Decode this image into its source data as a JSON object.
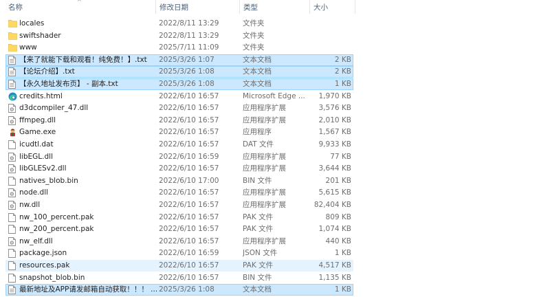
{
  "header": {
    "name": "名称",
    "date": "修改日期",
    "type": "类型",
    "size": "大小",
    "sort_arrow": "^"
  },
  "files": [
    {
      "name": "locales",
      "date": "2022/8/11 13:29",
      "type": "文件夹",
      "size": "",
      "icon": "folder-icon",
      "state": ""
    },
    {
      "name": "swiftshader",
      "date": "2022/8/11 13:29",
      "type": "文件夹",
      "size": "",
      "icon": "folder-icon",
      "state": ""
    },
    {
      "name": "www",
      "date": "2025/7/11 11:09",
      "type": "文件夹",
      "size": "",
      "icon": "folder-icon",
      "state": ""
    },
    {
      "name": "【来了就能下载和观看！纯免费！】.txt",
      "date": "2025/3/26 1:07",
      "type": "文本文档",
      "size": "2 KB",
      "icon": "text-file-icon",
      "state": "sel"
    },
    {
      "name": "【论坛介绍】.txt",
      "date": "2025/3/26 1:08",
      "type": "文本文档",
      "size": "2 KB",
      "icon": "text-file-icon",
      "state": "sel"
    },
    {
      "name": "【永久地址发布页】 - 副本.txt",
      "date": "2025/3/26 1:08",
      "type": "文本文档",
      "size": "1 KB",
      "icon": "text-file-icon",
      "state": "sel"
    },
    {
      "name": "credits.html",
      "date": "2022/6/10 16:57",
      "type": "Microsoft Edge ...",
      "size": "1,970 KB",
      "icon": "edge-icon",
      "state": ""
    },
    {
      "name": "d3dcompiler_47.dll",
      "date": "2022/6/10 16:57",
      "type": "应用程序扩展",
      "size": "3,576 KB",
      "icon": "dll-file-icon",
      "state": ""
    },
    {
      "name": "ffmpeg.dll",
      "date": "2022/6/10 16:57",
      "type": "应用程序扩展",
      "size": "2,010 KB",
      "icon": "dll-file-icon",
      "state": ""
    },
    {
      "name": "Game.exe",
      "date": "2022/6/10 16:57",
      "type": "应用程序",
      "size": "1,567 KB",
      "icon": "game-exe-icon",
      "state": ""
    },
    {
      "name": "icudtl.dat",
      "date": "2022/6/10 16:57",
      "type": "DAT 文件",
      "size": "9,933 KB",
      "icon": "blank-file-icon",
      "state": ""
    },
    {
      "name": "libEGL.dll",
      "date": "2022/6/10 16:59",
      "type": "应用程序扩展",
      "size": "77 KB",
      "icon": "dll-file-icon",
      "state": ""
    },
    {
      "name": "libGLESv2.dll",
      "date": "2022/6/10 16:57",
      "type": "应用程序扩展",
      "size": "3,644 KB",
      "icon": "dll-file-icon",
      "state": ""
    },
    {
      "name": "natives_blob.bin",
      "date": "2022/6/10 17:00",
      "type": "BIN 文件",
      "size": "201 KB",
      "icon": "blank-file-icon",
      "state": ""
    },
    {
      "name": "node.dll",
      "date": "2022/6/10 16:57",
      "type": "应用程序扩展",
      "size": "5,615 KB",
      "icon": "dll-file-icon",
      "state": ""
    },
    {
      "name": "nw.dll",
      "date": "2022/6/10 16:57",
      "type": "应用程序扩展",
      "size": "82,404 KB",
      "icon": "dll-file-icon",
      "state": ""
    },
    {
      "name": "nw_100_percent.pak",
      "date": "2022/6/10 16:57",
      "type": "PAK 文件",
      "size": "809 KB",
      "icon": "blank-file-icon",
      "state": ""
    },
    {
      "name": "nw_200_percent.pak",
      "date": "2022/6/10 16:57",
      "type": "PAK 文件",
      "size": "1,074 KB",
      "icon": "blank-file-icon",
      "state": ""
    },
    {
      "name": "nw_elf.dll",
      "date": "2022/6/10 16:57",
      "type": "应用程序扩展",
      "size": "440 KB",
      "icon": "dll-file-icon",
      "state": ""
    },
    {
      "name": "package.json",
      "date": "2022/6/10 16:59",
      "type": "JSON 文件",
      "size": "1 KB",
      "icon": "blank-file-icon",
      "state": ""
    },
    {
      "name": "resources.pak",
      "date": "2022/6/10 16:57",
      "type": "PAK 文件",
      "size": "4,517 KB",
      "icon": "blank-file-icon",
      "state": "hover"
    },
    {
      "name": "snapshot_blob.bin",
      "date": "2022/6/10 16:57",
      "type": "BIN 文件",
      "size": "1,135 KB",
      "icon": "blank-file-icon",
      "state": ""
    },
    {
      "name": "最新地址及APP请发邮箱自动获取！！！ ...",
      "date": "2025/3/26 1:08",
      "type": "文本文档",
      "size": "1 KB",
      "icon": "text-file-icon",
      "state": "sel"
    }
  ]
}
